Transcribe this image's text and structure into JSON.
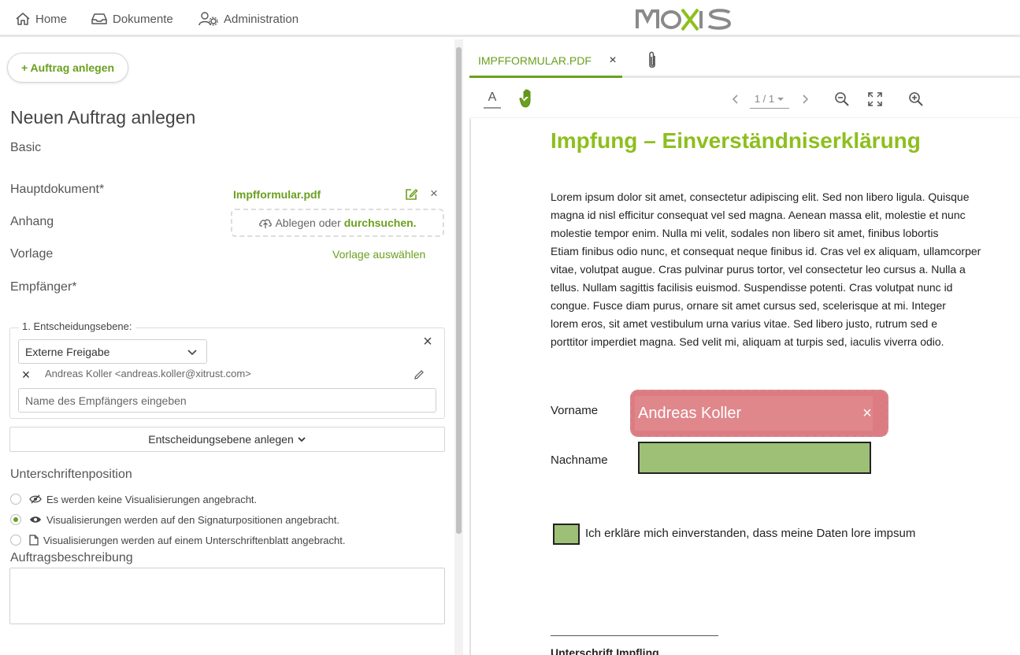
{
  "nav": {
    "home": "Home",
    "documents": "Dokumente",
    "administration": "Administration"
  },
  "logo_text": "MOXIS",
  "left": {
    "create_button": "+ Auftrag anlegen",
    "page_title": "Neuen Auftrag anlegen",
    "section": "Basic",
    "labels": {
      "main_document": "Hauptdokument*",
      "attachment": "Anhang",
      "template": "Vorlage",
      "recipient": "Empfänger*"
    },
    "main_document_file": "Impfformular.pdf",
    "dropzone_text": "Ablegen oder",
    "dropzone_browse": "durchsuchen.",
    "template_link": "Vorlage auswählen",
    "decision_level": {
      "legend": "1. Entscheidungsebene:",
      "select_value": "Externe Freigabe",
      "recipient": "Andreas Koller <andreas.koller@xitrust.com>",
      "recipient_placeholder": "Name des Empfängers eingeben"
    },
    "add_level_button": "Entscheidungsebene anlegen",
    "signature_position": {
      "title": "Unterschriftenposition",
      "options": [
        "Es werden keine Visualisierungen angebracht.",
        "Visualisierungen werden auf den Signaturpositionen angebracht.",
        "Visualisierungen werden auf einem Unterschriftenblatt angebracht."
      ],
      "selected_index": 1
    },
    "description_label": "Auftragsbeschreibung"
  },
  "viewer": {
    "tab_label": "IMPFFORMULAR.PDF",
    "page_indicator": "1 / 1",
    "doc_title": "Impfung – Einverständniserklärung",
    "paragraph_lines": [
      "Lorem ipsum dolor sit amet, consectetur adipiscing elit. Sed non libero ligula. Quisque",
      "magna id nisl efficitur consequat vel sed magna. Aenean massa elit, molestie et nunc",
      "molestie tempor enim. Nulla mi velit, sodales non libero sit amet, finibus lobortis",
      "Etiam finibus odio nunc, et consequat neque finibus id. Cras vel ex aliquam, ullamcorper",
      "vitae, volutpat augue. Cras pulvinar purus tortor, vel consectetur leo cursus a. Nulla a",
      "tellus. Nullam sagittis facilisis euismod. Suspendisse potenti. Cras volutpat nunc id",
      "congue. Fusce diam purus, ornare sit amet cursus sed, scelerisque at mi. Integer",
      "lorem eros, sit amet vestibulum urna varius vitae. Sed libero justo, rutrum sed e",
      "porttitor imperdiet magna. Sed velit mi, aliquam at turpis sed, iaculis viverra odio."
    ],
    "first_name_label": "Vorname",
    "first_name_value": "Andreas Koller",
    "last_name_label": "Nachname",
    "consent_text": "Ich erkläre mich einverstanden, dass meine Daten lore impsum",
    "signature_caption": "Unterschrift Impfling"
  },
  "colors": {
    "accent": "#6aa01e",
    "title_green": "#8dbf1e",
    "field_red": "#dc7c82",
    "field_green": "#9dc076"
  }
}
